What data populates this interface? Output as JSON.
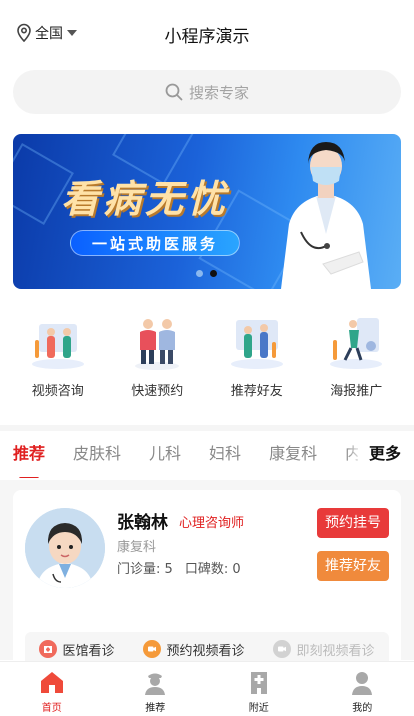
{
  "header": {
    "region": "全国",
    "title": "小程序演示"
  },
  "search": {
    "placeholder": "搜索专家"
  },
  "banner": {
    "headline": "看病无忧",
    "tagline": "一站式助医服务",
    "slide_count": 2,
    "active_slide": 2
  },
  "quick_nav": [
    {
      "label": "视频咨询",
      "icon": "video-consult-icon"
    },
    {
      "label": "快速预约",
      "icon": "quick-booking-icon"
    },
    {
      "label": "推荐好友",
      "icon": "recommend-friend-icon"
    },
    {
      "label": "海报推广",
      "icon": "poster-promo-icon"
    }
  ],
  "tabs": {
    "items": [
      "推荐",
      "皮肤科",
      "儿科",
      "妇科",
      "康复科",
      "内"
    ],
    "active": 0,
    "more_label": "更多"
  },
  "doctor": {
    "name": "张翰林",
    "role": "心理咨询师",
    "department": "康复科",
    "visits_label": "门诊量:",
    "visits": "5",
    "rating_label": "口碑数:",
    "rating": "0",
    "book_label": "预约挂号",
    "share_label": "推荐好友",
    "services": [
      {
        "label": "医馆看诊",
        "icon": "clinic-icon",
        "color": "#f06a5c",
        "enabled": true
      },
      {
        "label": "预约视频看诊",
        "icon": "video-icon",
        "color": "#f59a3a",
        "enabled": true
      },
      {
        "label": "即刻视频看诊",
        "icon": "video-icon",
        "color": "#cccccc",
        "enabled": false
      }
    ]
  },
  "bottom_nav": [
    {
      "label": "首页",
      "icon": "home-icon",
      "active": true
    },
    {
      "label": "推荐",
      "icon": "doctor-icon",
      "active": false
    },
    {
      "label": "附近",
      "icon": "hospital-icon",
      "active": false
    },
    {
      "label": "我的",
      "icon": "user-icon",
      "active": false
    }
  ],
  "colors": {
    "accent": "#e02020",
    "book_button": "#e83a3a",
    "share_button": "#f08a3c",
    "banner_blue": "#1b62d9"
  }
}
